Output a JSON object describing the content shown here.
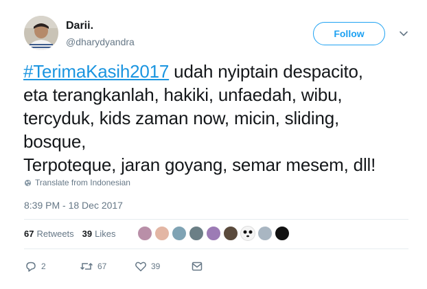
{
  "user": {
    "name": "Darii.",
    "handle": "@dharydyandra"
  },
  "follow_label": "Follow",
  "tweet": {
    "hashtag": "#TerimaKasih2017",
    "line1_rest": " udah nyiptain despacito,",
    "line2": "eta terangkanlah, hakiki, unfaedah, wibu,",
    "line3": "tercyduk, kids zaman now, micin, sliding,",
    "line4": "bosque,",
    "line5": "Terpoteque, jaran goyang, semar mesem, dll!"
  },
  "translate_label": "Translate from Indonesian",
  "timestamp": "8:39 PM - 18 Dec 2017",
  "stats": {
    "retweets_count": "67",
    "retweets_label": "Retweets",
    "likes_count": "39",
    "likes_label": "Likes"
  },
  "actions": {
    "reply_count": "2",
    "retweet_count": "67",
    "like_count": "39"
  },
  "colors": {
    "accent": "#1da1f2",
    "hashtag": "#1b95e0",
    "muted": "#657786"
  },
  "icons": [
    "caret-down-icon",
    "globe-icon",
    "reply-icon",
    "retweet-icon",
    "heart-icon",
    "message-icon"
  ]
}
